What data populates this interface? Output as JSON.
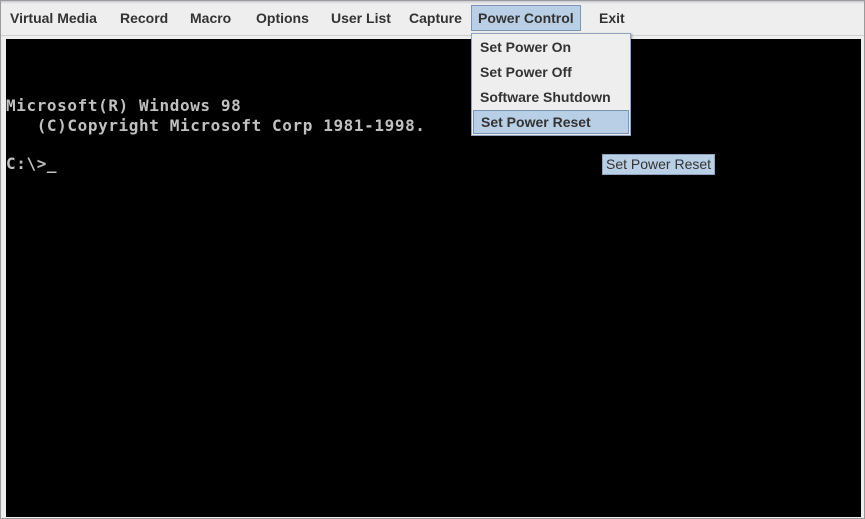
{
  "menubar": {
    "items": [
      {
        "label": "Virtual Media"
      },
      {
        "label": "Record"
      },
      {
        "label": "Macro"
      },
      {
        "label": "Options"
      },
      {
        "label": "User List"
      },
      {
        "label": "Capture"
      },
      {
        "label": "Power Control",
        "active": true
      },
      {
        "label": "Exit"
      }
    ]
  },
  "power_menu": {
    "items": [
      {
        "label": "Set Power On"
      },
      {
        "label": "Set Power Off"
      },
      {
        "label": "Software Shutdown"
      },
      {
        "label": "Set Power Reset",
        "highlighted": true
      }
    ]
  },
  "tooltip": {
    "text": "Set Power Reset"
  },
  "console": {
    "lines": [
      "Microsoft(R) Windows 98",
      "   (C)Copyright Microsoft Corp 1981-1998.",
      "C:\\>_"
    ]
  },
  "colors": {
    "menu_background": "#eeeeee",
    "highlight": "#b8cfe5",
    "highlight_border": "#7a96b4",
    "console_background": "#000000",
    "console_text": "#c0c0c0"
  }
}
